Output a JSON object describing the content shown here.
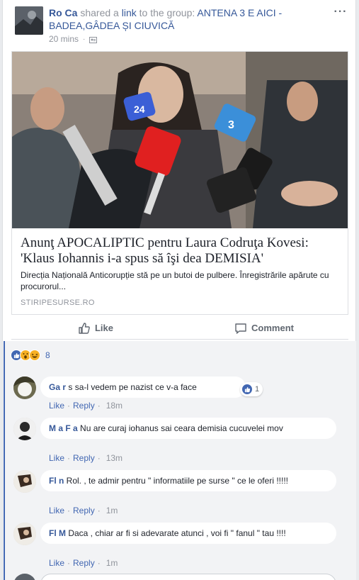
{
  "post": {
    "author": "Ro       Ca",
    "shared_text": "shared a",
    "link_word": "link",
    "to_text": "to the group:",
    "group": "ANTENA 3 E AICI - BADEA,GÂDEA ȘI CIUVICĂ",
    "time": "20 mins",
    "more": "···"
  },
  "link_card": {
    "title": "Anunţ APOCALIPTIC pentru Laura Codruţa Kovesi: 'Klaus Iohannis i-a spus să îşi dea DEMISIA'",
    "description": "Direcția Națională Anticorupție stă pe un butoi de pulbere. Înregistrările apărute cu procurorul...",
    "domain": "STIRIPESURSE.RO",
    "image_labels": {
      "mic1": "24",
      "mic2": "3"
    }
  },
  "actions": {
    "like": "Like",
    "comment": "Comment"
  },
  "reactions": {
    "count": "8"
  },
  "comments": [
    {
      "author": "Ga         r",
      "text": "s sa-l vedem pe nazist ce v-a face",
      "like": "Like",
      "reply": "Reply",
      "time": "18m",
      "reaction_count": "1"
    },
    {
      "author": "M    a  F     a",
      "text": "Nu are curaj iohanus sai ceara demisia cucuvelei mov",
      "like": "Like",
      "reply": "Reply",
      "time": "13m"
    },
    {
      "author": "Fl          n",
      "text": "Rol.          , te admir pentru \" informatiile pe surse \" ce le oferi !!!!!",
      "like": "Like",
      "reply": "Reply",
      "time": "1m"
    },
    {
      "author": "Fl       M    ",
      "text": "Daca , chiar ar fi si adevarate atunci , voi fi \" fanul \" tau !!!!",
      "like": "Like",
      "reply": "Reply",
      "time": "1m"
    }
  ]
}
